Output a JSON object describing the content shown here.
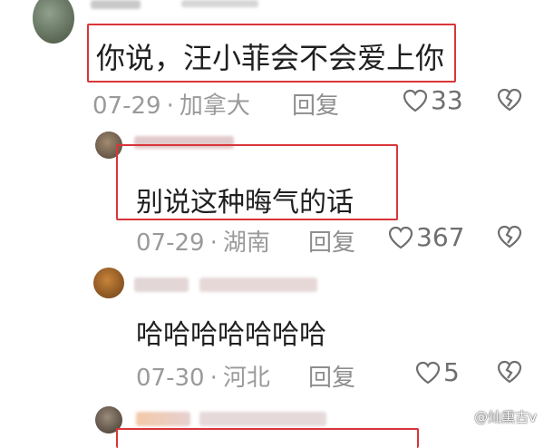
{
  "comments": [
    {
      "text": "你说，汪小菲会不会爱上你",
      "date": "07-29",
      "location": "加拿大",
      "reply_label": "回复",
      "likes": "33"
    },
    {
      "text": "别说这种晦气的话",
      "date": "07-29",
      "location": "湖南",
      "reply_label": "回复",
      "likes": "367"
    },
    {
      "text": "哈哈哈哈哈哈哈",
      "date": "07-30",
      "location": "河北",
      "reply_label": "回复",
      "likes": "5"
    }
  ],
  "separator": "·",
  "watermark": "@灿熏古v",
  "colors": {
    "highlight_box": "#d9353a",
    "meta_text": "#9a9a9a"
  }
}
